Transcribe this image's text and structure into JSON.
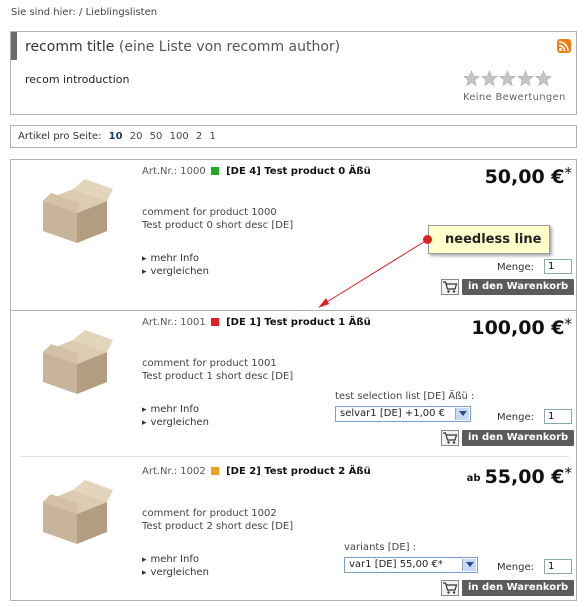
{
  "breadcrumb": "Sie sind hier: / Lieblingslisten",
  "list": {
    "title": "recomm title",
    "subtitle": "(eine Liste von recomm author)",
    "introduction": "recom introduction",
    "rating_text": "Keine Bewertungen",
    "stars_filled": 0,
    "stars_total": 5,
    "rss_icon": "rss-icon"
  },
  "per_page": {
    "label": "Artikel pro Seite:",
    "options": [
      "10",
      "20",
      "50",
      "100",
      "2",
      "1"
    ],
    "active": "10"
  },
  "products": [
    {
      "art_label": "Art.Nr.:",
      "art_nr": "1000",
      "status_color": "#22aa22",
      "name": "[DE 4] Test product 0 Äßü",
      "price_prefix": "",
      "price": "50,00 €",
      "price_suffix": "*",
      "comment": "comment for product 1000",
      "short_desc": "Test product 0 short desc [DE]",
      "more_info": "mehr Info",
      "compare": "vergleichen",
      "menge_label": "Menge:",
      "quantity": "1",
      "cart_label": "in den Warenkorb"
    },
    {
      "art_label": "Art.Nr.:",
      "art_nr": "1001",
      "status_color": "#dd2222",
      "name": "[DE 1] Test product 1 Äßü",
      "price_prefix": "",
      "price": "100,00 €",
      "price_suffix": "*",
      "comment": "comment for product 1001",
      "short_desc": "Test product 1 short desc [DE]",
      "more_info": "mehr Info",
      "compare": "vergleichen",
      "selection_label": "test selection list [DE] Äßü :",
      "selection_value": "selvar1 [DE] +1,00 €",
      "menge_label": "Menge:",
      "quantity": "1",
      "cart_label": "in den Warenkorb"
    },
    {
      "art_label": "Art.Nr.:",
      "art_nr": "1002",
      "status_color": "#f0a020",
      "name": "[DE 2] Test product 2 Äßü",
      "price_prefix": "ab",
      "price": "55,00 €",
      "price_suffix": "*",
      "comment": "comment for product 1002",
      "short_desc": "Test product 2 short desc [DE]",
      "more_info": "mehr Info",
      "compare": "vergleichen",
      "selection_label": "variants [DE] :",
      "selection_value": "var1 [DE] 55,00 €*",
      "menge_label": "Menge:",
      "quantity": "1",
      "cart_label": "in den Warenkorb"
    }
  ],
  "annotation": {
    "text": "needless line",
    "color": "#dd2222"
  }
}
